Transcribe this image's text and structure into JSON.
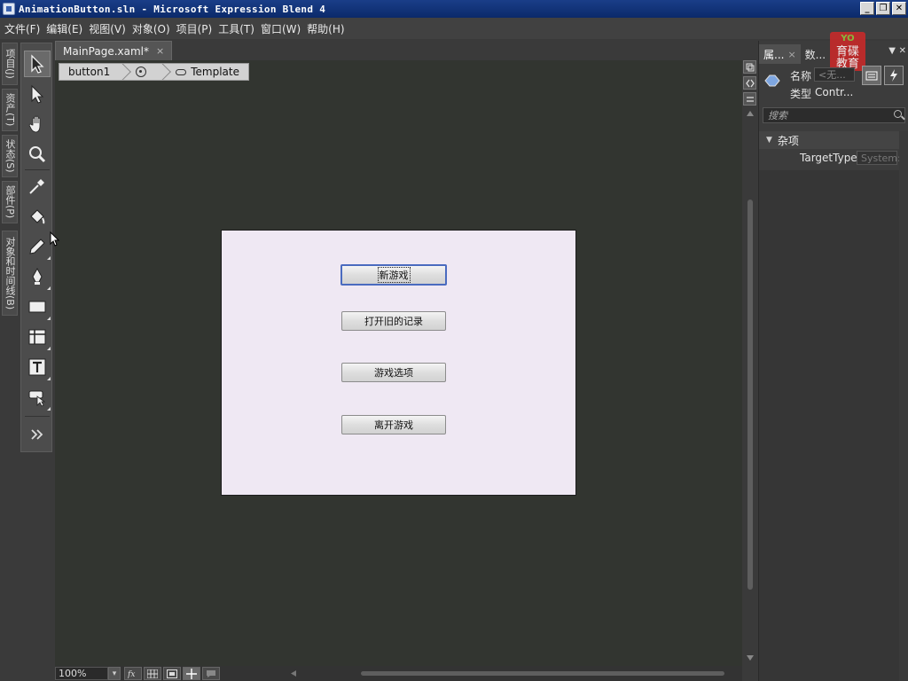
{
  "window": {
    "title": "AnimationButton.sln - Microsoft Expression Blend 4",
    "controls": [
      "_",
      "❐",
      "✕"
    ]
  },
  "menu": [
    "文件(F)",
    "编辑(E)",
    "视图(V)",
    "对象(O)",
    "项目(P)",
    "工具(T)",
    "窗口(W)",
    "帮助(H)"
  ],
  "side_tabs": [
    "项目(J)",
    "资产(T)",
    "状态(S)",
    "部件(P)",
    "对象和时间线(B)"
  ],
  "tools": [
    "selection-tool",
    "direct-selection-tool",
    "pan-tool",
    "zoom-tool",
    "eyedropper-tool",
    "paint-bucket-tool",
    "brush-transform-tool",
    "pen-tool",
    "rectangle-tool",
    "grid-tool",
    "text-tool",
    "asset-tool",
    "asset-library-toggle"
  ],
  "document": {
    "tab_label": "MainPage.xaml*",
    "tab_close": "×",
    "breadcrumb": {
      "item1": "button1",
      "item3": "Template"
    }
  },
  "artboard": {
    "buttons": [
      "新游戏",
      "打开旧的记录",
      "游戏选项",
      "离开游戏"
    ]
  },
  "status": {
    "zoom": "100%"
  },
  "properties": {
    "tab1": "属...",
    "tab2": "数...",
    "logo_top": "YO",
    "logo_text1": "育碟",
    "logo_text2": "教育",
    "name_label": "名称",
    "name_placeholder": "<无...",
    "type_label": "类型",
    "type_value": "Contr...",
    "search_placeholder": "搜索",
    "category": "杂项",
    "target_type_label": "TargetType",
    "target_type_value": "System:"
  }
}
